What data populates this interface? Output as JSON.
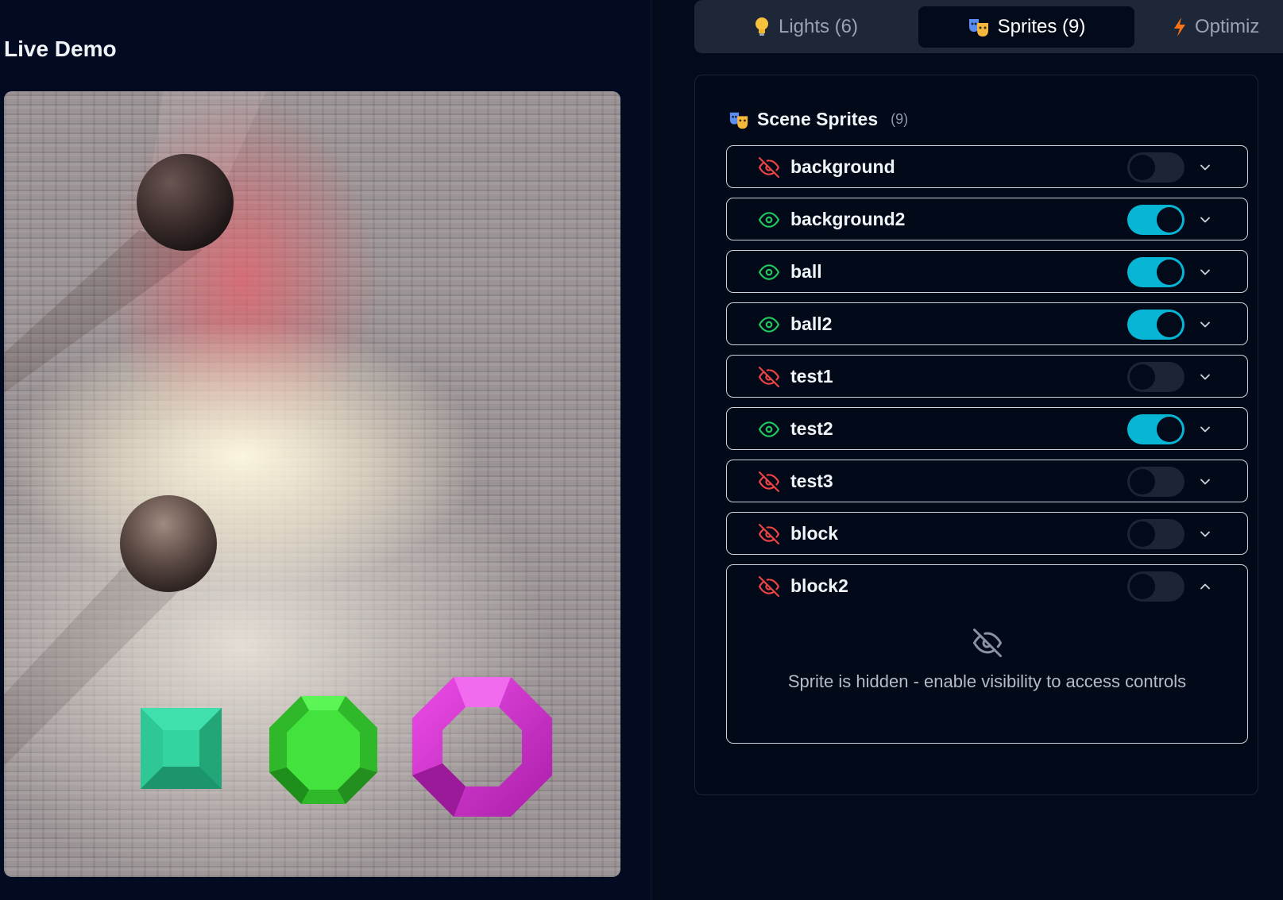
{
  "left_panel": {
    "title": "Live Demo"
  },
  "tabs": [
    {
      "label": "Lights (6)",
      "icon": "lightbulb-icon",
      "active": false
    },
    {
      "label": "Sprites (9)",
      "icon": "theater-masks-icon",
      "active": true
    },
    {
      "label": "Optimiz",
      "icon": "lightning-icon",
      "active": false
    }
  ],
  "sprites_panel": {
    "title": "Scene Sprites",
    "count": "(9)",
    "hidden_message": "Sprite is hidden - enable visibility to access controls",
    "items": [
      {
        "name": "background",
        "visible": false,
        "expanded": false
      },
      {
        "name": "background2",
        "visible": true,
        "expanded": false
      },
      {
        "name": "ball",
        "visible": true,
        "expanded": false
      },
      {
        "name": "ball2",
        "visible": true,
        "expanded": false
      },
      {
        "name": "test1",
        "visible": false,
        "expanded": false
      },
      {
        "name": "test2",
        "visible": true,
        "expanded": false
      },
      {
        "name": "test3",
        "visible": false,
        "expanded": false
      },
      {
        "name": "block",
        "visible": false,
        "expanded": false
      },
      {
        "name": "block2",
        "visible": false,
        "expanded": true
      }
    ]
  },
  "colors": {
    "toggle_on": "#06b6d4",
    "visible_icon": "#22c55e",
    "hidden_icon": "#ef4444",
    "gem_square": "#2fc99a",
    "gem_octagon": "#3fdc3a",
    "ring": "#d22fcf"
  }
}
